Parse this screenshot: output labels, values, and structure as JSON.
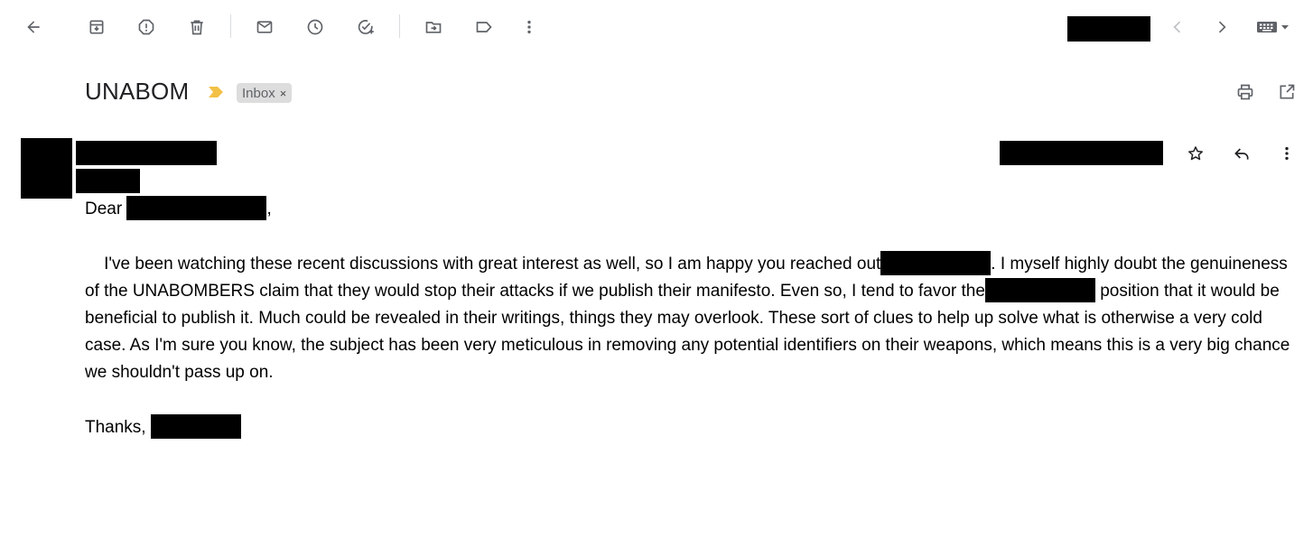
{
  "email": {
    "subject": "UNABOM",
    "label_chip": "Inbox",
    "chip_remove": "×",
    "body": {
      "greeting_prefix": "Dear ",
      "greeting_suffix": ",",
      "p1_a": "    I've been watching these recent discussions with great interest as well, so I am happy you reached out",
      "p1_b": ". I myself highly doubt the genuineness of the UNABOMBERS claim that they would stop their attacks if we publish their manifesto. Even so, I tend to favor the",
      "p1_c": " position that it would be beneficial to publish it. Much could be revealed in their writings, things they may overlook. These sort of clues to help up solve what is otherwise a very cold case. As I'm sure you know, the subject has been very meticulous in removing any potential identifiers on their weapons, which means this is a very big chance we shouldn't pass up on.",
      "closing": "Thanks, "
    }
  },
  "colors": {
    "icon": "#5f6368",
    "important_marker": "#f2c046",
    "chip_bg": "#dddddd"
  }
}
